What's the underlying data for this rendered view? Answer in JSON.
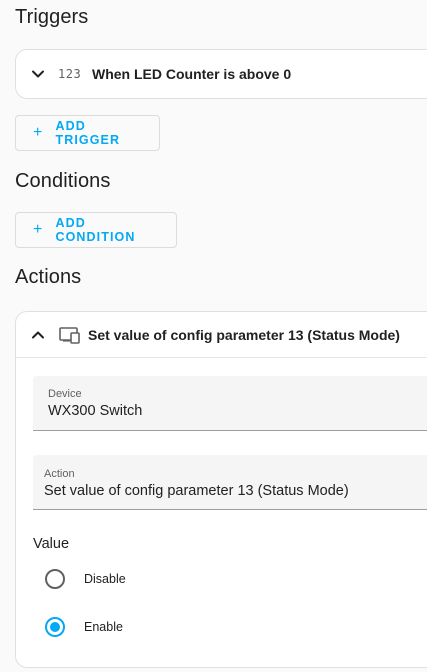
{
  "triggers": {
    "title": "Triggers",
    "items": [
      {
        "type_icon_text": "123",
        "label": "When LED Counter is above 0"
      }
    ],
    "add_label": "ADD TRIGGER"
  },
  "conditions": {
    "title": "Conditions",
    "add_label": "ADD CONDITION"
  },
  "actions": {
    "title": "Actions",
    "items": [
      {
        "label": "Set value of config parameter 13 (Status Mode)",
        "device_field": {
          "label": "Device",
          "value": "WX300 Switch"
        },
        "action_field": {
          "label": "Action",
          "value": "Set value of config parameter 13 (Status Mode)"
        },
        "value_label": "Value",
        "options": [
          {
            "label": "Disable",
            "selected": false
          },
          {
            "label": "Enable",
            "selected": true
          }
        ]
      }
    ]
  },
  "colors": {
    "accent": "#03a9f4",
    "text": "#212121",
    "border": "#e0e0e0"
  }
}
